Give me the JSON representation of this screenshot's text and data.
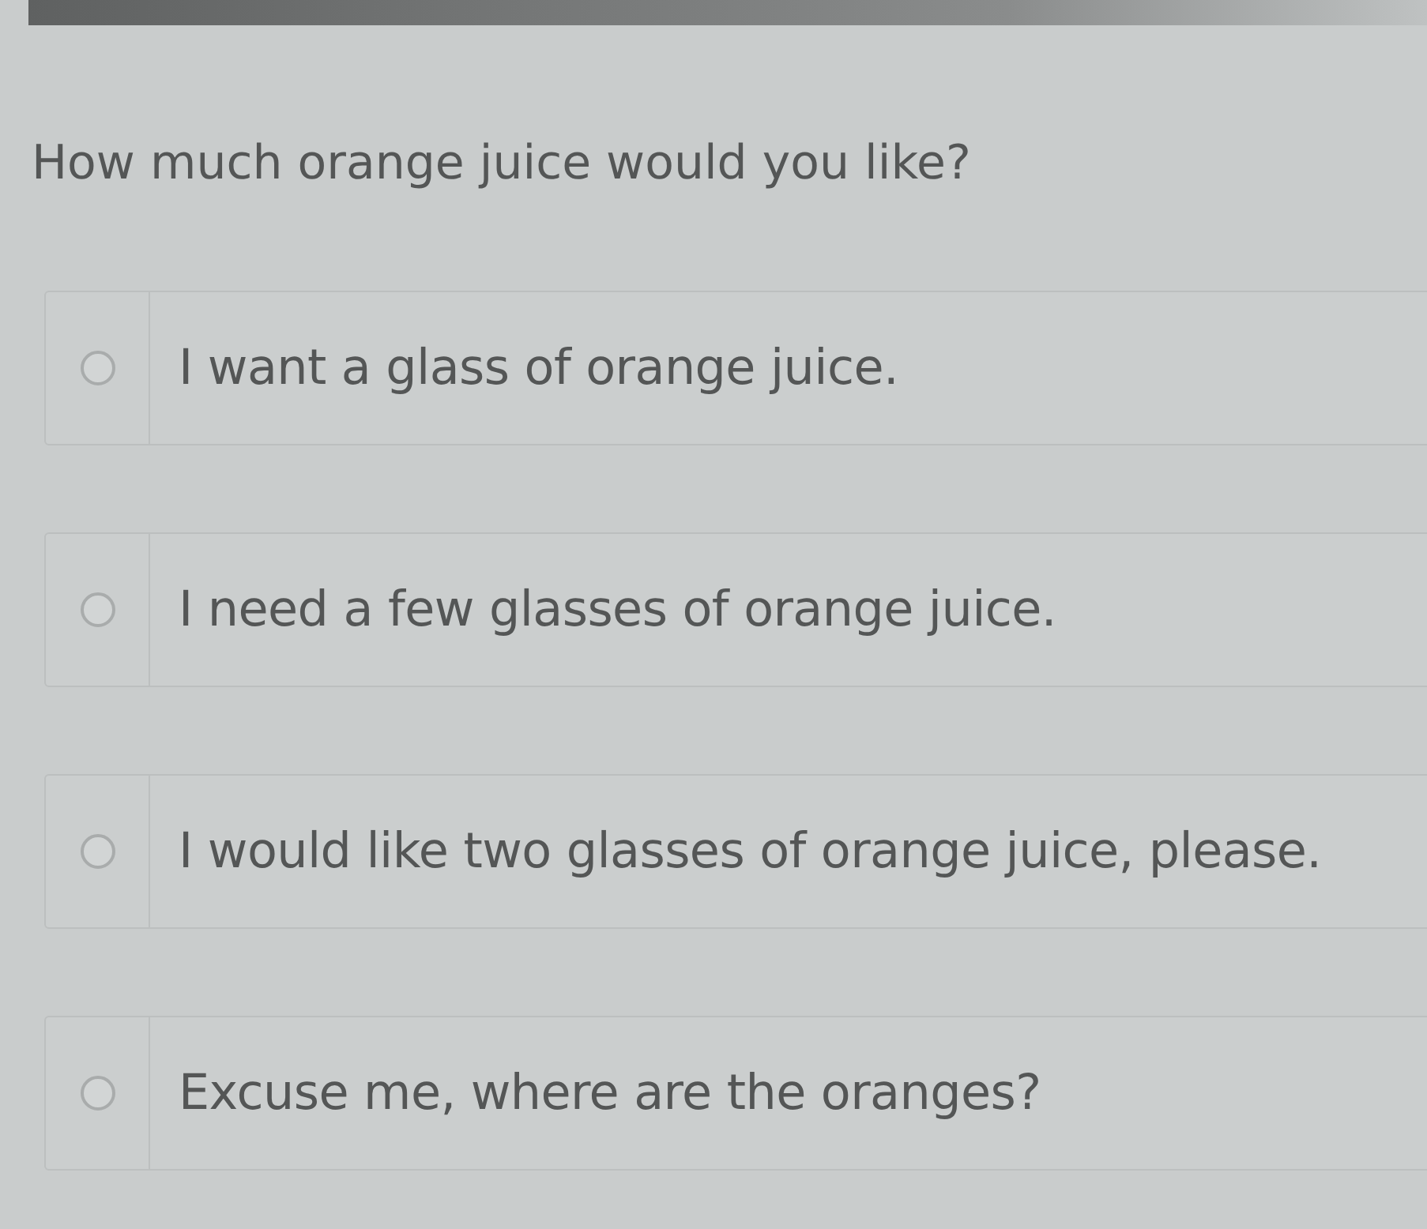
{
  "question": "How much orange juice would you like?",
  "options": [
    {
      "label": "I want a glass of orange juice.",
      "selected": false
    },
    {
      "label": "I need a few glasses of orange juice.",
      "selected": false
    },
    {
      "label": "I would like two glasses of orange juice, please.",
      "selected": false
    },
    {
      "label": "Excuse me, where are the oranges?",
      "selected": false
    }
  ]
}
